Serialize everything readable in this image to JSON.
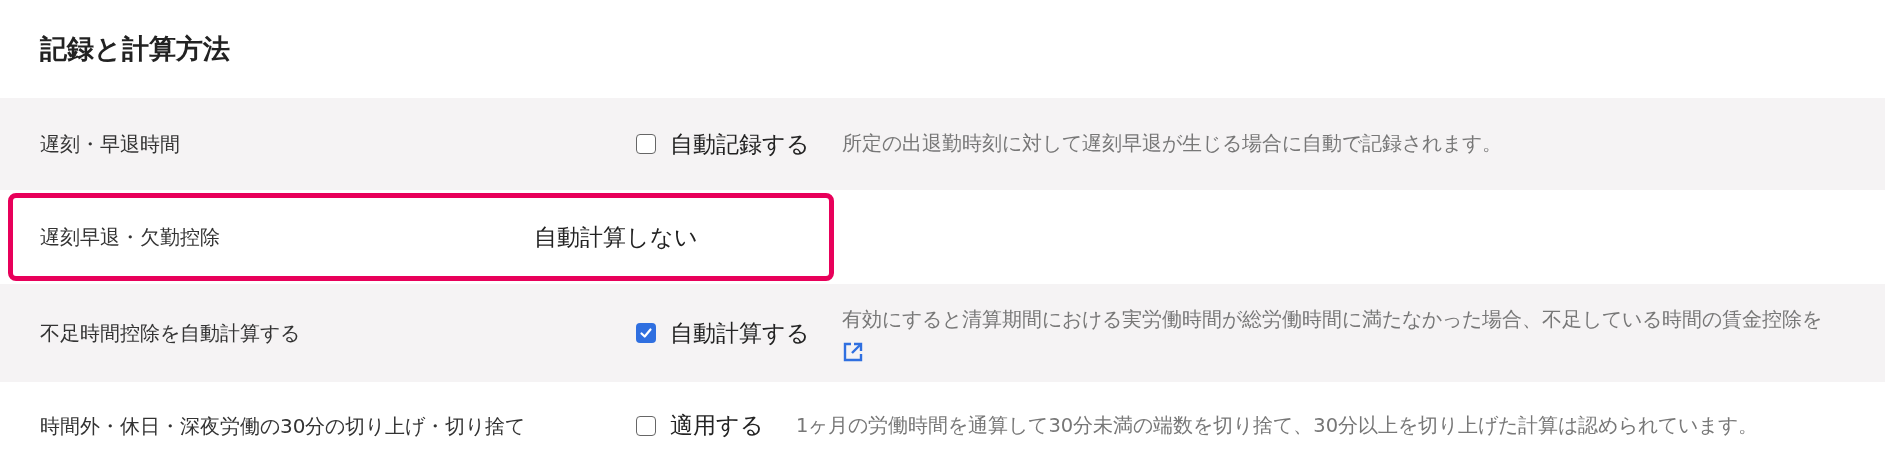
{
  "section_title": "記録と計算方法",
  "rows": [
    {
      "label": "遅刻・早退時間",
      "kind": "checkbox",
      "checked": false,
      "highlighted": false,
      "control_label": "自動記録する",
      "description": "所定の出退勤時刻に対して遅刻早退が生じる場合に自動で記録されます。"
    },
    {
      "label": "遅刻早退・欠勤控除",
      "kind": "text",
      "highlighted": true,
      "value": "自動計算しない"
    },
    {
      "label": "不足時間控除を自動計算する",
      "kind": "checkbox",
      "checked": true,
      "highlighted": false,
      "control_label": "自動計算する",
      "description": "有効にすると清算期間における実労働時間が総労働時間に満たなかった場合、不足している時間の賃金控除を",
      "has_link": true
    },
    {
      "label": "時間外・休日・深夜労働の30分の切り上げ・切り捨て",
      "kind": "checkbox",
      "checked": false,
      "highlighted": false,
      "control_label": "適用する",
      "description": "1ヶ月の労働時間を通算して30分未満の端数を切り捨て、30分以上を切り上げた計算は認められています。"
    }
  ]
}
